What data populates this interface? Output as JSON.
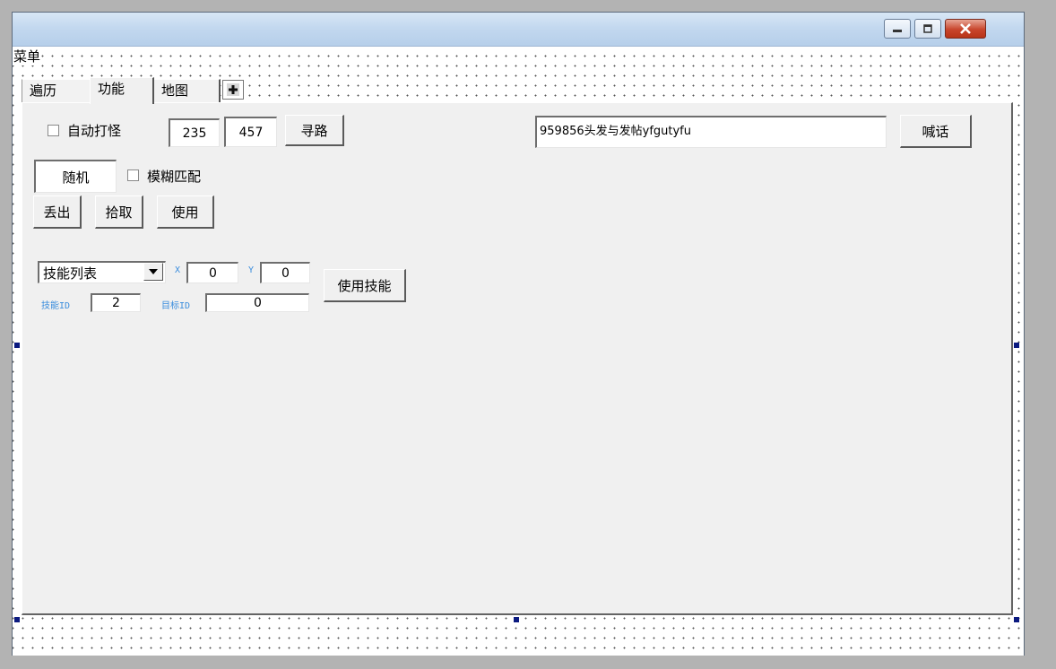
{
  "menu": {
    "label": "菜单"
  },
  "tabs": [
    {
      "label": "遍历"
    },
    {
      "label": "功能"
    },
    {
      "label": "地图"
    }
  ],
  "function_panel": {
    "auto_fight": {
      "label": "自动打怪",
      "checked": false
    },
    "coord_x": "235",
    "coord_y": "457",
    "pathfind_label": "寻路",
    "chat_text": "959856头发与发帖yfgutyfu",
    "shout_label": "喊话",
    "random_field": "随机",
    "fuzzy_match": {
      "label": "模糊匹配",
      "checked": false
    },
    "drop_label": "丢出",
    "pickup_label": "拾取",
    "use_label": "使用",
    "skill_select": {
      "selected": "技能列表"
    },
    "x_label": "X",
    "x_value": "0",
    "y_label": "Y",
    "y_value": "0",
    "use_skill_label": "使用技能",
    "skill_id_label": "技能ID",
    "skill_id_value": "2",
    "target_id_label": "目标ID",
    "target_id_value": "0"
  },
  "icons": [
    "minimize-icon",
    "maximize-icon",
    "close-icon",
    "add-tab-icon",
    "dropdown-arrow-icon"
  ],
  "colors": {
    "titlebar": "#c3d8ef",
    "panel": "#f0f0f0",
    "close_button": "#c8452c",
    "mini_label": "#3a8ddd"
  }
}
